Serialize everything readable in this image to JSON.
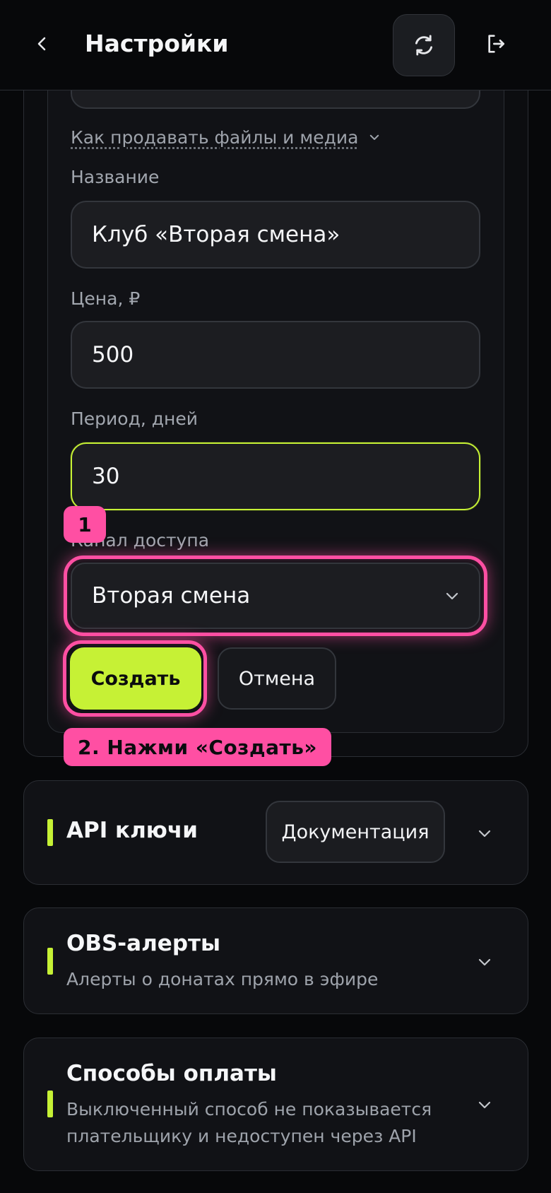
{
  "header": {
    "title": "Настройки"
  },
  "form": {
    "media_link": "Как продавать файлы и медиа",
    "name_label": "Название",
    "name_value": "Клуб «Вторая смена»",
    "price_label": "Цена, ₽",
    "price_value": "500",
    "period_label": "Период, дней",
    "period_value": "30",
    "channel_label": "Канал доступа",
    "channel_value": "Вторая смена",
    "create_label": "Создать",
    "cancel_label": "Отмена"
  },
  "hints": {
    "step1": "1",
    "step2": "2. Нажми «Создать»"
  },
  "sections": [
    {
      "title": "API ключи",
      "button": "Документация"
    },
    {
      "title": "OBS-алерты",
      "desc": "Алерты о донатах прямо в эфире"
    },
    {
      "title": "Способы оплаты",
      "desc_line1": "Выключенный способ не показывается",
      "desc_line2": "плательщику и недоступен через API"
    }
  ],
  "colors": {
    "accent": "#c6f135",
    "highlight": "#ff4fa3",
    "background": "#07080a"
  }
}
